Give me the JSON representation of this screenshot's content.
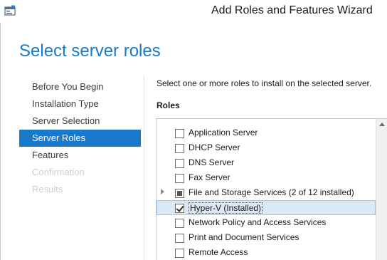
{
  "window": {
    "title": "Add Roles and Features Wizard",
    "icon": "server-manager-icon"
  },
  "page": {
    "title": "Select server roles"
  },
  "nav": {
    "items": [
      {
        "label": "Before You Begin",
        "state": "normal"
      },
      {
        "label": "Installation Type",
        "state": "normal"
      },
      {
        "label": "Server Selection",
        "state": "normal"
      },
      {
        "label": "Server Roles",
        "state": "active"
      },
      {
        "label": "Features",
        "state": "normal"
      },
      {
        "label": "Confirmation",
        "state": "disabled"
      },
      {
        "label": "Results",
        "state": "disabled"
      }
    ]
  },
  "content": {
    "instruction": "Select one or more roles to install on the selected server.",
    "roles_label": "Roles"
  },
  "roles": [
    {
      "label": "Application Server",
      "checked": "unchecked",
      "expandable": false,
      "selected": false
    },
    {
      "label": "DHCP Server",
      "checked": "unchecked",
      "expandable": false,
      "selected": false
    },
    {
      "label": "DNS Server",
      "checked": "unchecked",
      "expandable": false,
      "selected": false
    },
    {
      "label": "Fax Server",
      "checked": "unchecked",
      "expandable": false,
      "selected": false
    },
    {
      "label": "File and Storage Services (2 of 12 installed)",
      "checked": "partial",
      "expandable": true,
      "selected": false
    },
    {
      "label": "Hyper-V (Installed)",
      "checked": "checked",
      "expandable": false,
      "selected": true
    },
    {
      "label": "Network Policy and Access Services",
      "checked": "unchecked",
      "expandable": false,
      "selected": false
    },
    {
      "label": "Print and Document Services",
      "checked": "unchecked",
      "expandable": false,
      "selected": false
    },
    {
      "label": "Remote Access",
      "checked": "unchecked",
      "expandable": false,
      "selected": false
    }
  ],
  "colors": {
    "accent": "#1979ca",
    "selection_bg": "#dbe9f7",
    "disabled_text": "#cfcfcf"
  }
}
